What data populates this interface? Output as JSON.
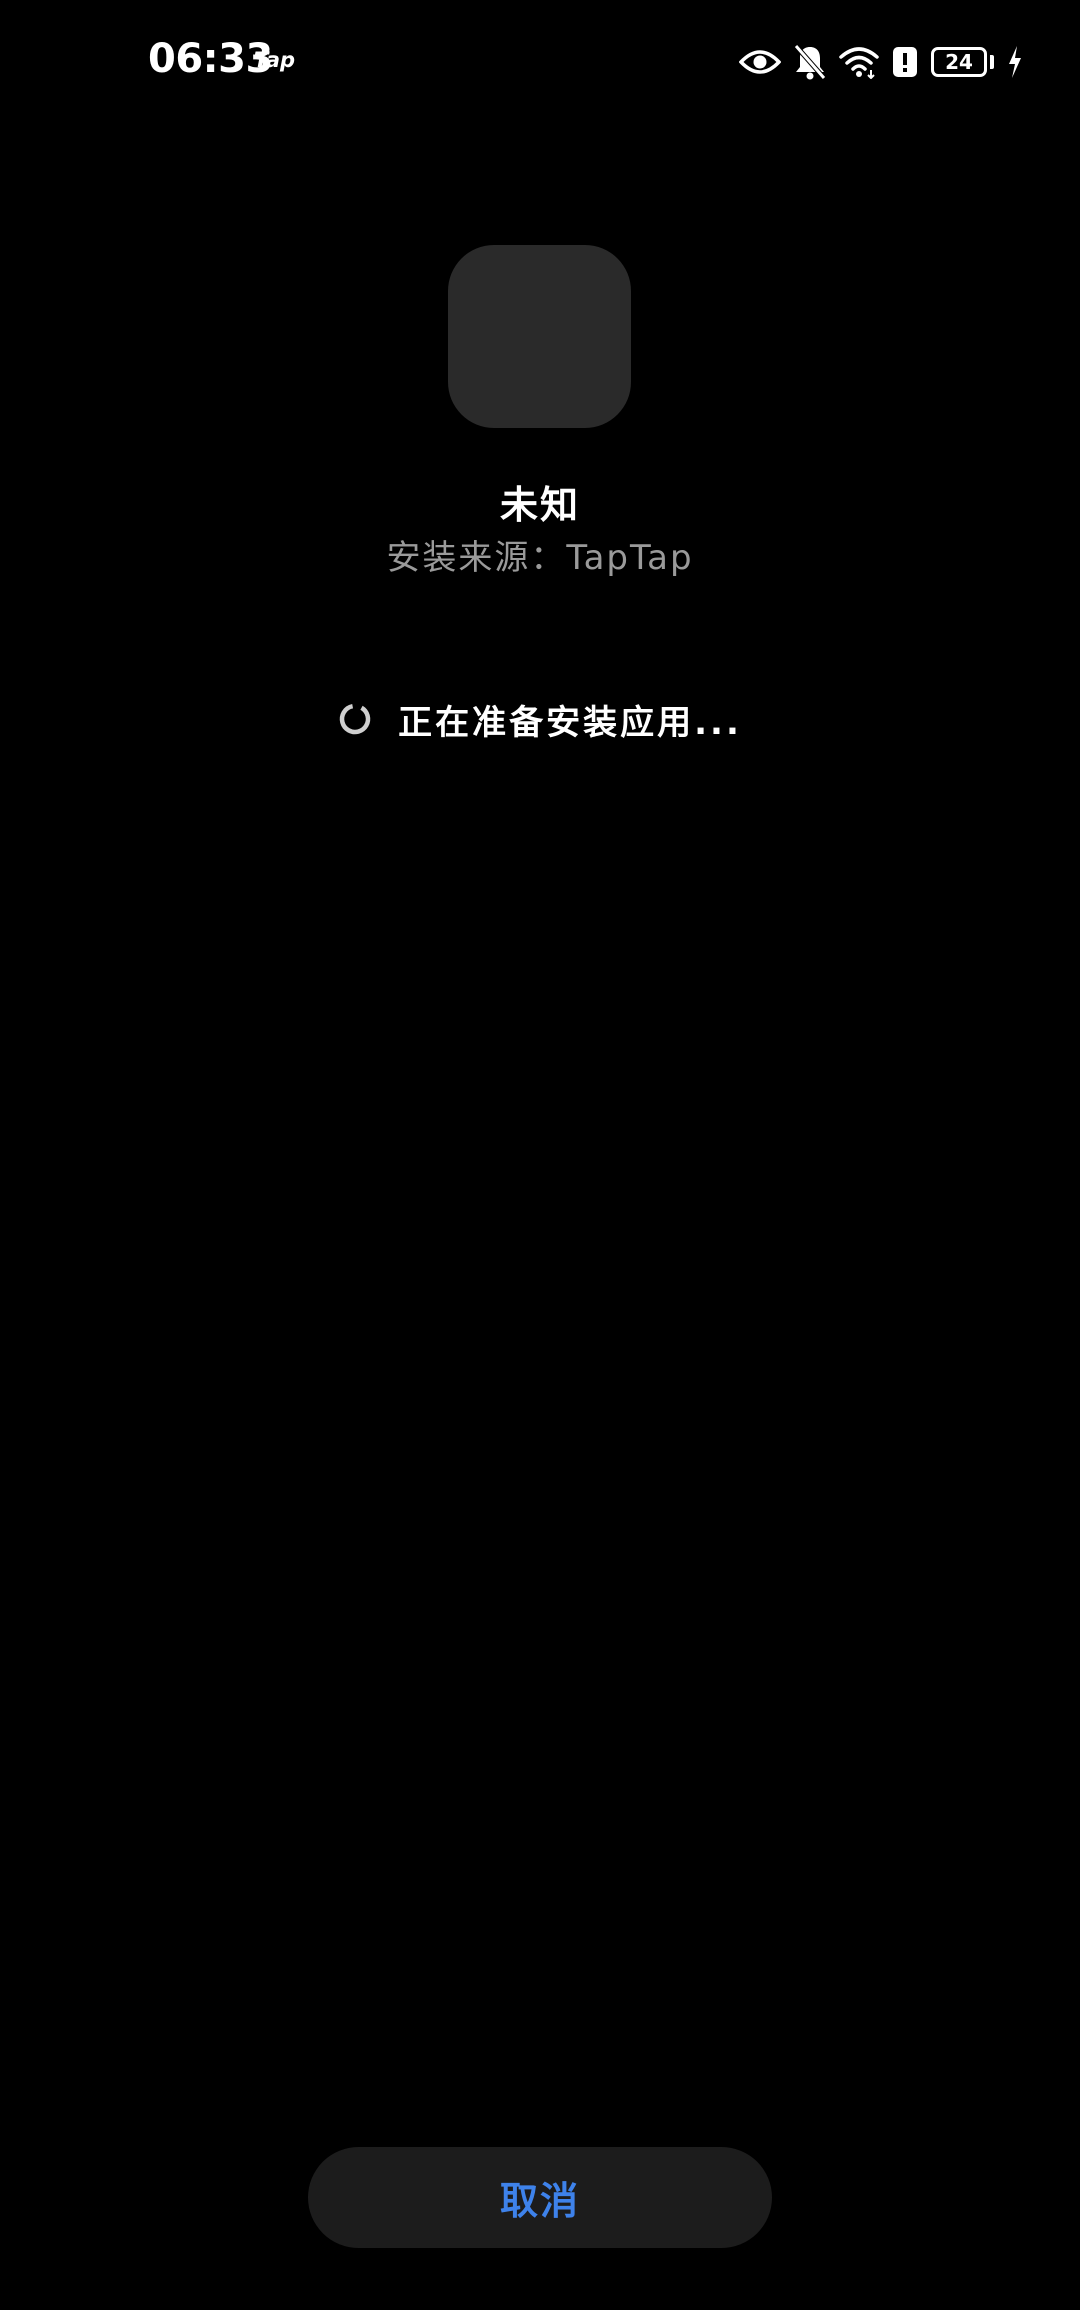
{
  "status_bar": {
    "time": "06:33",
    "app_label": "Tap",
    "battery_level": "24",
    "icons": [
      "eye-icon",
      "bell-off-icon",
      "wifi-icon",
      "alert-icon",
      "battery-icon",
      "charging-bolt-icon"
    ]
  },
  "app": {
    "name": "未知",
    "source": "安装来源：TapTap"
  },
  "progress": {
    "text": "正在准备安装应用..."
  },
  "actions": {
    "cancel_label": "取消"
  },
  "colors": {
    "background": "#000000",
    "icon_placeholder": "#2a2a2a",
    "secondary_text": "#9a9a9a",
    "button_bg": "#1c1c1c",
    "accent": "#3e82ea"
  }
}
